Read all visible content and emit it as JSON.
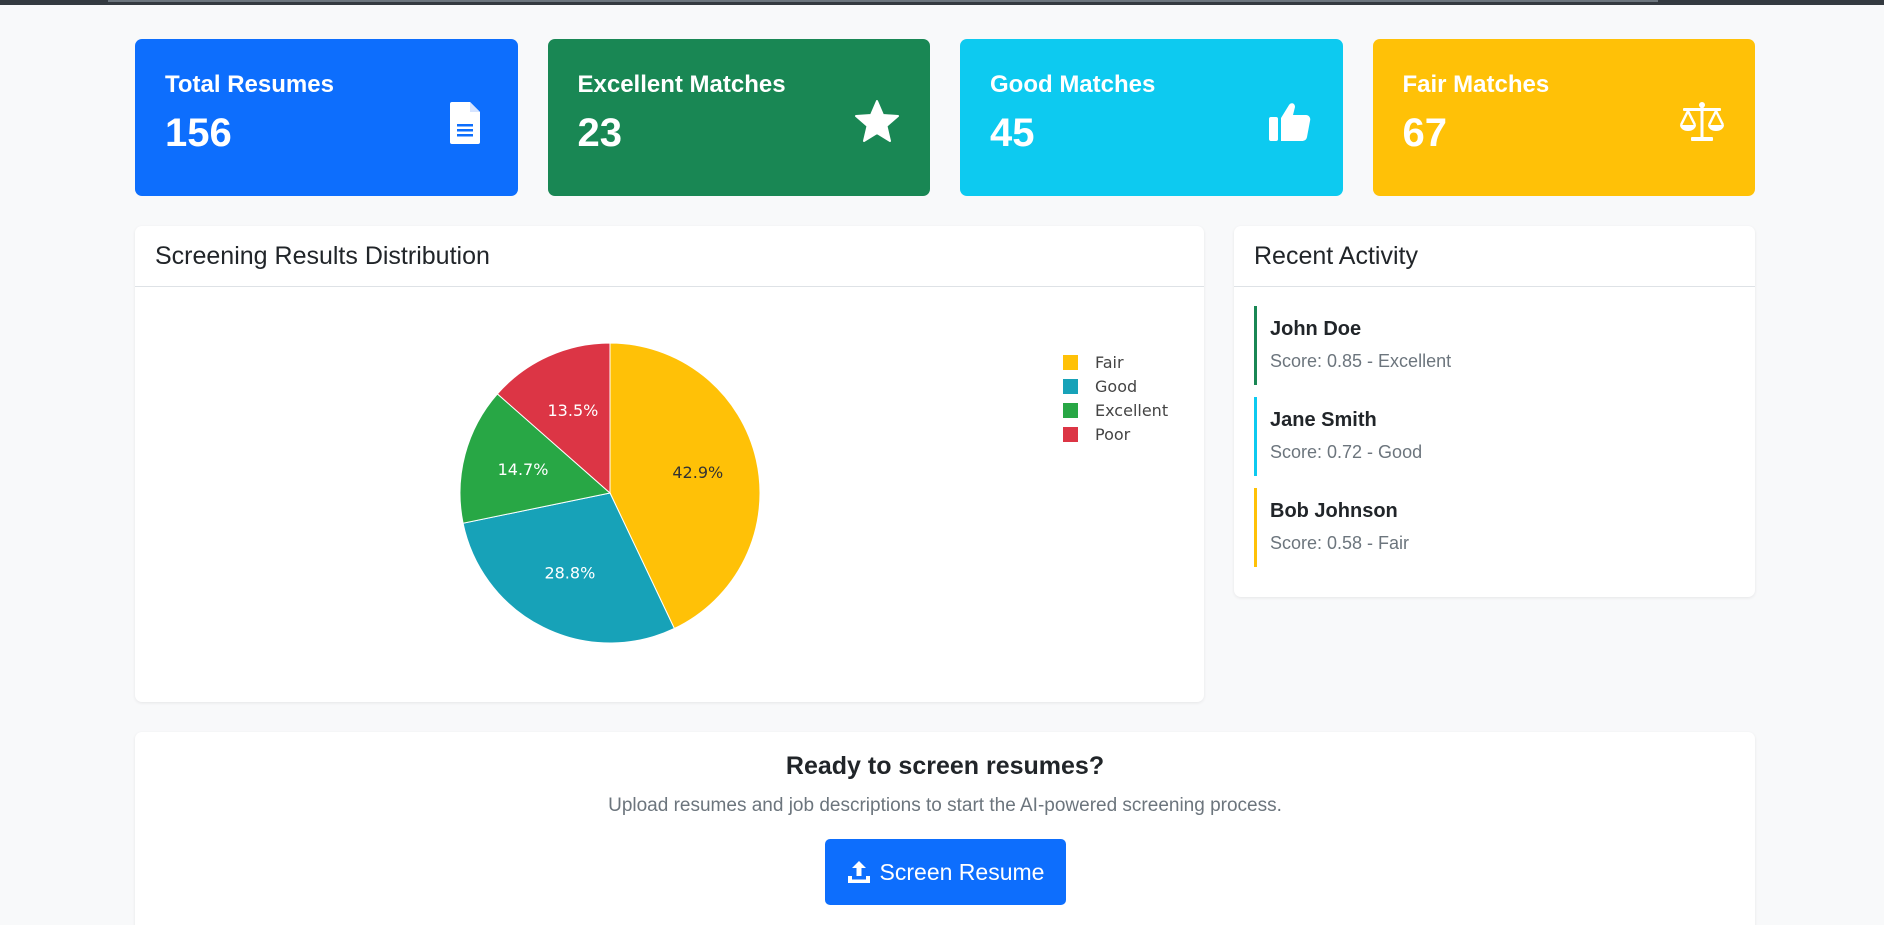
{
  "stats": [
    {
      "title": "Total Resumes",
      "value": "156",
      "color": "#0d6efd",
      "icon": "file-icon"
    },
    {
      "title": "Excellent Matches",
      "value": "23",
      "color": "#198754",
      "icon": "star-icon"
    },
    {
      "title": "Good Matches",
      "value": "45",
      "color": "#0dcaf0",
      "icon": "thumbs-up-icon"
    },
    {
      "title": "Fair Matches",
      "value": "67",
      "color": "#ffc107",
      "icon": "balance-scale-icon"
    }
  ],
  "chart_panel": {
    "title": "Screening Results Distribution"
  },
  "chart_data": {
    "type": "pie",
    "categories": [
      "Fair",
      "Good",
      "Excellent",
      "Poor"
    ],
    "values": [
      42.9,
      28.8,
      14.7,
      13.5
    ],
    "labels": [
      "42.9%",
      "28.8%",
      "14.7%",
      "13.5%"
    ],
    "colors": [
      "#ffc107",
      "#17a2b8",
      "#28a745",
      "#dc3545"
    ],
    "legend_position": "top-right"
  },
  "activity": {
    "title": "Recent Activity",
    "items": [
      {
        "name": "John Doe",
        "score": "Score: 0.85 - Excellent",
        "color": "#198754"
      },
      {
        "name": "Jane Smith",
        "score": "Score: 0.72 - Good",
        "color": "#0dcaf0"
      },
      {
        "name": "Bob Johnson",
        "score": "Score: 0.58 - Fair",
        "color": "#ffc107"
      }
    ]
  },
  "cta": {
    "title": "Ready to screen resumes?",
    "text": "Upload resumes and job descriptions to start the AI-powered screening process.",
    "button_label": "Screen Resume",
    "button_icon": "upload-icon"
  }
}
